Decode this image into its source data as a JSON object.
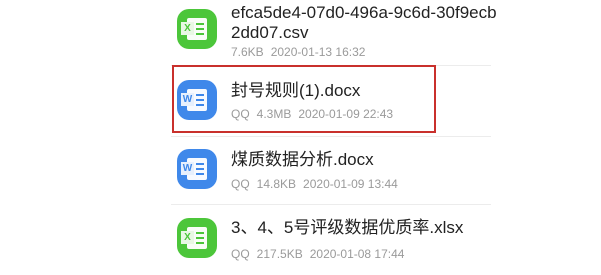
{
  "files": [
    {
      "name_line1": "efca5de4-07d0-496a-9c6d-30f9ecb",
      "name_line2": "2dd07.csv",
      "size": "7.6KB",
      "date": "2020-01-13 16:32",
      "icon": "excel-file-icon",
      "icon_letter": "X",
      "icon_color": "#4cc63a"
    },
    {
      "name": "封号规则(1).docx",
      "source": "QQ",
      "size": "4.3MB",
      "date": "2020-01-09 22:43",
      "icon": "word-file-icon",
      "icon_letter": "W",
      "icon_color": "#3f88ea",
      "highlighted": true
    },
    {
      "name": "煤质数据分析.docx",
      "source": "QQ",
      "size": "14.8KB",
      "date": "2020-01-09 13:44",
      "icon": "word-file-icon",
      "icon_letter": "W",
      "icon_color": "#3f88ea"
    },
    {
      "name": "3、4、5号评级数据优质率.xlsx",
      "source": "QQ",
      "size": "217.5KB",
      "date": "2020-01-08 17:44",
      "icon": "excel-file-icon",
      "icon_letter": "X",
      "icon_color": "#4cc63a"
    }
  ],
  "highlight_color": "#c9302c"
}
